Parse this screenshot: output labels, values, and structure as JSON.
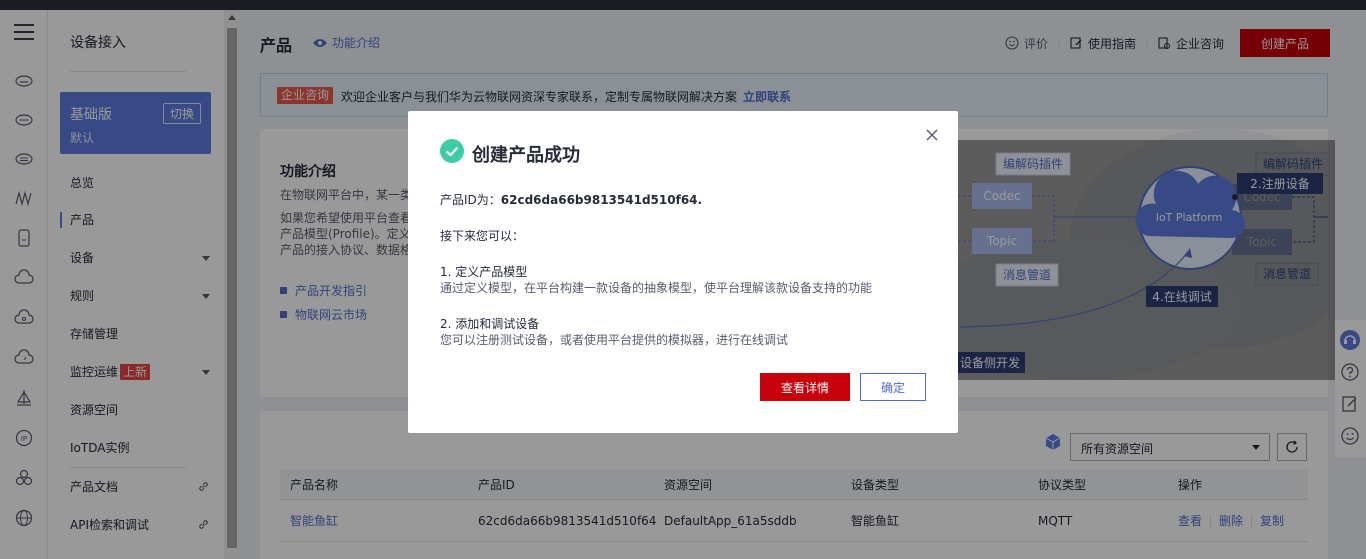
{
  "sidebar": {
    "title": "设备接入",
    "edition": {
      "name": "基础版",
      "sub": "默认",
      "switch_label": "切换"
    },
    "items": [
      {
        "label": "总览"
      },
      {
        "label": "产品"
      },
      {
        "label": "设备"
      },
      {
        "label": "规则"
      },
      {
        "label": "存储管理"
      },
      {
        "label": "监控运维",
        "badge": "上新"
      },
      {
        "label": "资源空间"
      },
      {
        "label": "IoTDA实例"
      },
      {
        "label": "产品文档"
      },
      {
        "label": "API检索和调试"
      }
    ]
  },
  "header": {
    "title": "产品",
    "feature_link": "功能介绍",
    "actions": {
      "rate": "评价",
      "guide": "使用指南",
      "consult": "企业咨询",
      "create": "创建产品"
    }
  },
  "notice": {
    "tag": "企业咨询",
    "text": "欢迎企业客户与我们华为云物联网资深专家联系，定制专属物联网解决方案",
    "cta": "立即联系"
  },
  "intro": {
    "title": "功能介绍",
    "p1": "在物联网平台中，某一类",
    "p2_line1": "如果您希望使用平台查看",
    "p2_line2": "产品模型(Profile)。定义",
    "p2_line3": "产品的接入协议、数据格",
    "links": [
      "产品开发指引",
      "物联网云市场"
    ],
    "diagram": {
      "codec_plugin": "编解码插件",
      "codec": "Codec",
      "topic": "Topic",
      "msg_pipe": "消息管道",
      "platform": "IoT Platform",
      "step2": "2.注册设备",
      "step4": "4.在线调试",
      "device_dev": "设备侧开发"
    }
  },
  "list": {
    "resource_select": "所有资源空间",
    "columns": [
      "产品名称",
      "产品ID",
      "资源空间",
      "设备类型",
      "协议类型",
      "操作"
    ],
    "rows": [
      {
        "name": "智能鱼缸",
        "id": "62cd6da66b9813541d510f64",
        "space": "DefaultApp_61a5sddb",
        "type": "智能鱼缸",
        "protocol": "MQTT",
        "ops": [
          "查看",
          "删除",
          "复制"
        ]
      }
    ]
  },
  "modal": {
    "title": "创建产品成功",
    "id_label": "产品ID为：",
    "id_value": "62cd6da66b9813541d510f64.",
    "next": "接下来您可以：",
    "step1_title": "1. 定义产品模型",
    "step1_desc": "通过定义模型，在平台构建一款设备的抽象模型，使平台理解该款设备支持的功能",
    "step2_title": "2. 添加和调试设备",
    "step2_desc": "您可以注册测试设备，或者使用平台提供的模拟器，进行在线调试",
    "detail_btn": "查看详情",
    "ok_btn": "确定"
  },
  "colors": {
    "brand_red": "#c7000b",
    "accent_blue": "#526ecc",
    "edition_blue": "#5e7ce0",
    "success_green": "#3dcca6"
  }
}
